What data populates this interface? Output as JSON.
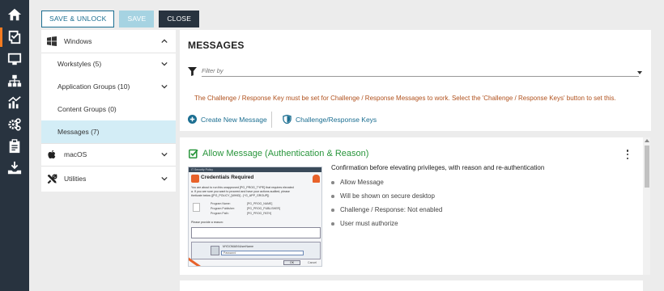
{
  "rail": {
    "items": [
      {
        "icon": "home-icon",
        "active": false
      },
      {
        "icon": "policy-icon",
        "active": true
      },
      {
        "icon": "computer-icon",
        "active": false
      },
      {
        "icon": "hierarchy-icon",
        "active": false
      },
      {
        "icon": "analytics-icon",
        "active": false
      },
      {
        "icon": "settings-icon",
        "active": false
      },
      {
        "icon": "clipboard-icon",
        "active": false
      },
      {
        "icon": "deploy-icon",
        "active": false
      }
    ],
    "accent": "#f47b20",
    "background": "#28333f"
  },
  "toolbar": {
    "save_unlock_label": "SAVE & UNLOCK",
    "save_label": "SAVE",
    "close_label": "CLOSE"
  },
  "nav": {
    "windows_label": "Windows",
    "items": [
      {
        "label": "Workstyles (5)",
        "expandable": true
      },
      {
        "label": "Application Groups (10)",
        "expandable": true
      },
      {
        "label": "Content Groups (0)",
        "expandable": false
      },
      {
        "label": "Messages (7)",
        "expandable": false,
        "selected": true
      }
    ],
    "macos_label": "macOS",
    "utilities_label": "Utilities"
  },
  "header": {
    "title": "MESSAGES",
    "filter_placeholder": "Filter by",
    "warning": "The Challenge / Response Key must be set for Challenge / Response Messages to work. Select the 'Challenge / Response Keys' button to set this.",
    "create_label": "Create New Message",
    "keys_label": "Challenge/Response Keys"
  },
  "card": {
    "title": "Allow Message (Authentication & Reason)",
    "description": "Confirmation before elevating privileges, with reason and re-authentication",
    "bullets": [
      "Allow Message",
      "Will be shown on secure desktop",
      "Challenge / Response: Not enabled",
      "User must authorize"
    ],
    "title_color": "#28953b"
  },
  "preview": {
    "bar_text": "IT Security Policy",
    "title": "Credentials Required",
    "lines": [
      "You are about to run this unapproved [PG_PROG_TYPE] that requires elevated",
      "a. If you are sure you want to proceed and have your actions audited, please",
      "theticate below ([PG_POLICY_[WHID] - [^G_APP_GROUP])"
    ],
    "fields": [
      {
        "label": "Program Name:",
        "value": "[PG_PROG_NAME]"
      },
      {
        "label": "Program Publisher:",
        "value": "[PG_PROG_PUBLISHER]"
      },
      {
        "label": "Program Path:",
        "value": "[PG_PROG_PATH]"
      }
    ],
    "reason_label": "Please provide a reason:",
    "user": "MYDOMAIN\\UserName",
    "password_placeholder": "Password",
    "ok_label": "OK",
    "cancel_label": "Cancel"
  }
}
